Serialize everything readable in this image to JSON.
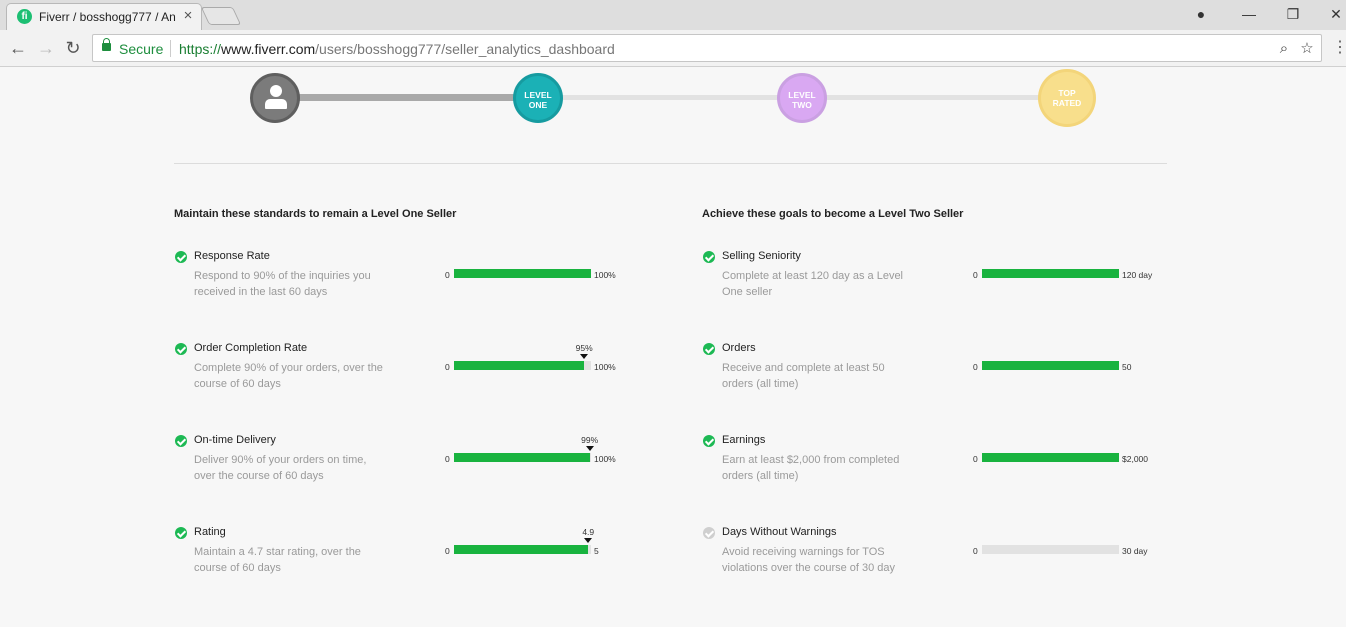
{
  "browser": {
    "tab_title": "Fiverr / bosshogg777 / An",
    "tab_favicon": "fi",
    "tab_close": "×",
    "secure_label": "Secure",
    "url_scheme": "https://",
    "url_host": "www.fiverr.com",
    "url_path": "/users/bosshogg777/seller_analytics_dashboard",
    "icons": {
      "back": "←",
      "forward": "→",
      "reload": "↻",
      "zoom": "⌕",
      "star": "☆",
      "menu": "⋮",
      "account": "●",
      "minimize": "—",
      "maximize": "❐",
      "close": "✕"
    }
  },
  "levels": {
    "one_line1": "LEVEL",
    "one_line2": "ONE",
    "two_line1": "LEVEL",
    "two_line2": "TWO",
    "top_line1": "TOP",
    "top_line2": "RATED"
  },
  "colors": {
    "accent_green": "#1db954",
    "bar_green": "#19b33f",
    "level_one": "#1bb1b6",
    "level_two": "#d9a8f2",
    "top_rated": "#f8df8c"
  },
  "left": {
    "heading": "Maintain these standards to remain a Level One Seller",
    "items": [
      {
        "title": "Response Rate",
        "desc": "Respond to 90% of the inquiries you received in the last 60 days",
        "min": "0",
        "max": "100%",
        "fill": 1.0,
        "marker": "",
        "marker_pos": null,
        "done": true
      },
      {
        "title": "Order Completion Rate",
        "desc": "Complete 90% of your orders, over the course of 60 days",
        "min": "0",
        "max": "100%",
        "fill": 0.95,
        "marker": "95%",
        "marker_pos": 0.95,
        "done": true
      },
      {
        "title": "On-time Delivery",
        "desc": "Deliver 90% of your orders on time, over the course of 60 days",
        "min": "0",
        "max": "100%",
        "fill": 0.99,
        "marker": "99%",
        "marker_pos": 0.99,
        "done": true
      },
      {
        "title": "Rating",
        "desc": "Maintain a 4.7 star rating, over the course of 60 days",
        "min": "0",
        "max": "5",
        "fill": 0.98,
        "marker": "4.9",
        "marker_pos": 0.98,
        "done": true
      }
    ]
  },
  "right": {
    "heading": "Achieve these goals to become a Level Two Seller",
    "items": [
      {
        "title": "Selling Seniority",
        "desc": "Complete at least 120 day as a Level One seller",
        "min": "0",
        "max": "120 day",
        "fill": 1.0,
        "marker": "",
        "marker_pos": null,
        "done": true
      },
      {
        "title": "Orders",
        "desc": "Receive and complete at least 50 orders (all time)",
        "min": "0",
        "max": "50",
        "fill": 1.0,
        "marker": "",
        "marker_pos": null,
        "done": true
      },
      {
        "title": "Earnings",
        "desc": "Earn at least $2,000 from completed orders (all time)",
        "min": "0",
        "max": "$2,000",
        "fill": 1.0,
        "marker": "",
        "marker_pos": null,
        "done": true
      },
      {
        "title": "Days Without Warnings",
        "desc": "Avoid receiving warnings for TOS violations over the course of 30 day",
        "min": "0",
        "max": "30 day",
        "fill": 0.0,
        "marker": "",
        "marker_pos": null,
        "done": false
      }
    ]
  }
}
